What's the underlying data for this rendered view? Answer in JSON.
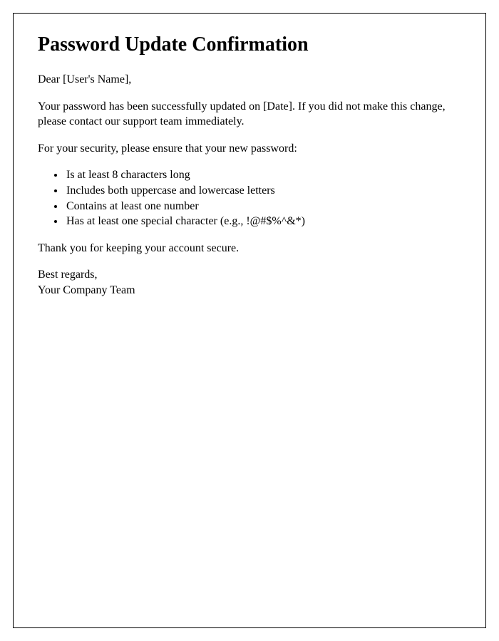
{
  "title": "Password Update Confirmation",
  "greeting": "Dear [User's Name],",
  "paragraph1": "Your password has been successfully updated on [Date]. If you did not make this change, please contact our support team immediately.",
  "paragraph2": "For your security, please ensure that your new password:",
  "requirements": [
    "Is at least 8 characters long",
    "Includes both uppercase and lowercase letters",
    "Contains at least one number",
    "Has at least one special character (e.g., !@#$%^&*)"
  ],
  "thankyou": "Thank you for keeping your account secure.",
  "closing_line1": "Best regards,",
  "closing_line2": "Your Company Team"
}
